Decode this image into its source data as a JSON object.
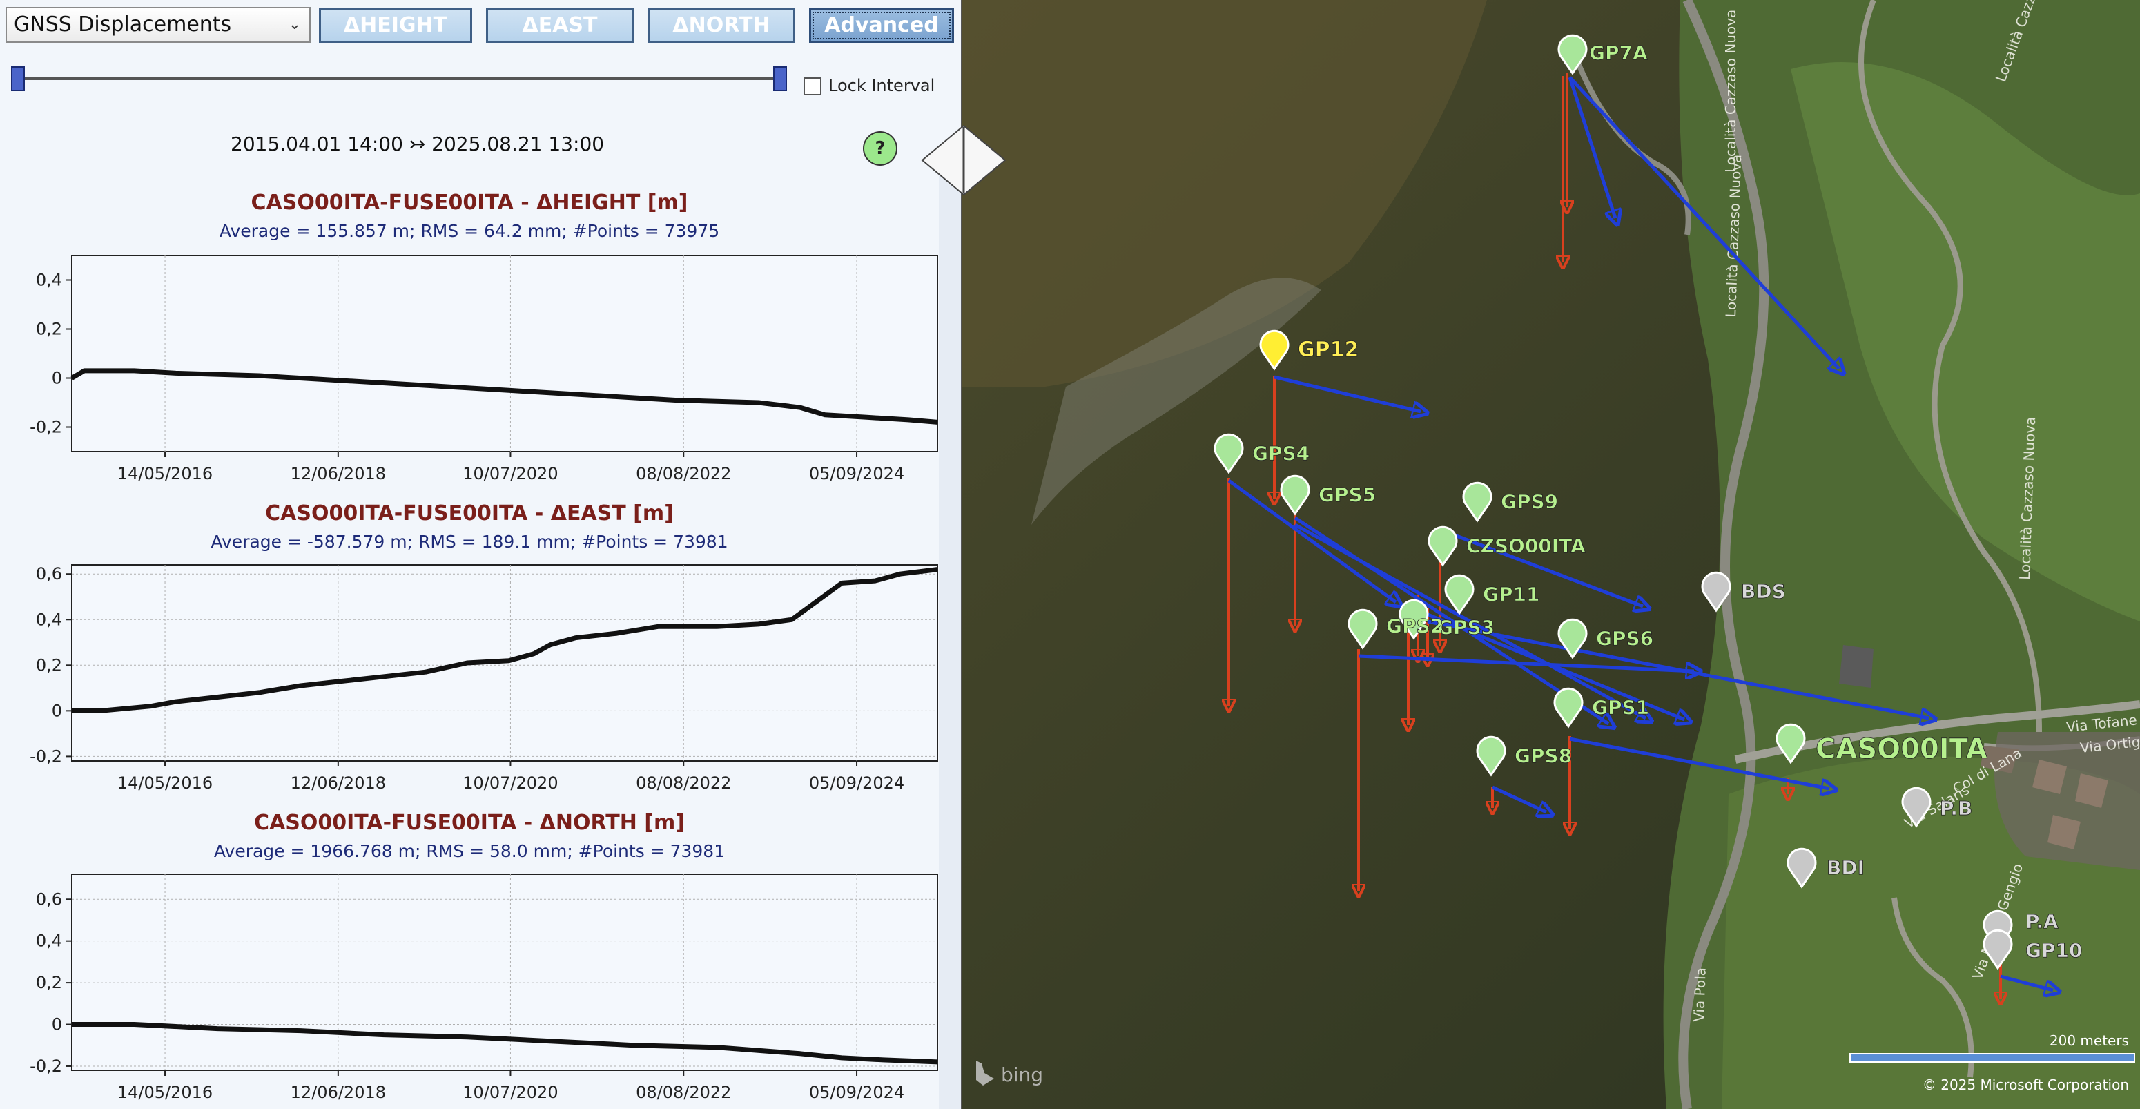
{
  "toolbar": {
    "dataset": "GNSS Displacements",
    "buttons": [
      "ΔHEIGHT",
      "ΔEAST",
      "ΔNORTH",
      "Advanced"
    ]
  },
  "interval": {
    "lock_label": "Lock Interval",
    "date_range": "2015.04.01 14:00 ↣ 2025.08.21 13:00"
  },
  "help": "?",
  "charts": [
    {
      "title": "CASO00ITA-FUSE00ITA - ΔHEIGHT [m]",
      "summary": "Average = 155.857 m; RMS = 64.2 mm; #Points = 73975",
      "ylim": [
        -0.3,
        0.5
      ],
      "yticks": [
        0.4,
        0.2,
        0,
        -0.2
      ],
      "ytick_labels": [
        "0,4",
        "0,2",
        "0",
        "-0,2"
      ],
      "xlim": [
        2015.25,
        2025.65
      ],
      "xticks": [
        2016.37,
        2018.45,
        2020.52,
        2022.6,
        2024.68
      ],
      "xtick_labels": [
        "14/05/2016",
        "12/06/2018",
        "10/07/2020",
        "08/08/2022",
        "05/09/2024"
      ],
      "series": [
        [
          2015.25,
          0.0
        ],
        [
          2015.4,
          0.03
        ],
        [
          2016.0,
          0.03
        ],
        [
          2016.5,
          0.02
        ],
        [
          2017.5,
          0.01
        ],
        [
          2018.5,
          -0.01
        ],
        [
          2019.5,
          -0.03
        ],
        [
          2020.5,
          -0.05
        ],
        [
          2021.5,
          -0.07
        ],
        [
          2022.5,
          -0.09
        ],
        [
          2023.5,
          -0.1
        ],
        [
          2024.0,
          -0.12
        ],
        [
          2024.3,
          -0.15
        ],
        [
          2024.8,
          -0.16
        ],
        [
          2025.3,
          -0.17
        ],
        [
          2025.65,
          -0.18
        ]
      ]
    },
    {
      "title": "CASO00ITA-FUSE00ITA - ΔEAST [m]",
      "summary": "Average = -587.579 m; RMS = 189.1 mm; #Points = 73981",
      "ylim": [
        -0.22,
        0.64
      ],
      "yticks": [
        0.6,
        0.4,
        0.2,
        0,
        -0.2
      ],
      "ytick_labels": [
        "0,6",
        "0,4",
        "0,2",
        "0",
        "-0,2"
      ],
      "xlim": [
        2015.25,
        2025.65
      ],
      "xticks": [
        2016.37,
        2018.45,
        2020.52,
        2022.6,
        2024.68
      ],
      "xtick_labels": [
        "14/05/2016",
        "12/06/2018",
        "10/07/2020",
        "08/08/2022",
        "05/09/2024"
      ],
      "series": [
        [
          2015.25,
          0.0
        ],
        [
          2015.6,
          0.0
        ],
        [
          2016.2,
          0.02
        ],
        [
          2016.5,
          0.04
        ],
        [
          2017.0,
          0.06
        ],
        [
          2017.5,
          0.08
        ],
        [
          2018.0,
          0.11
        ],
        [
          2018.5,
          0.13
        ],
        [
          2019.0,
          0.15
        ],
        [
          2019.5,
          0.17
        ],
        [
          2020.0,
          0.21
        ],
        [
          2020.5,
          0.22
        ],
        [
          2020.8,
          0.25
        ],
        [
          2021.0,
          0.29
        ],
        [
          2021.3,
          0.32
        ],
        [
          2021.8,
          0.34
        ],
        [
          2022.3,
          0.37
        ],
        [
          2023.0,
          0.37
        ],
        [
          2023.5,
          0.38
        ],
        [
          2023.9,
          0.4
        ],
        [
          2024.2,
          0.48
        ],
        [
          2024.5,
          0.56
        ],
        [
          2024.9,
          0.57
        ],
        [
          2025.2,
          0.6
        ],
        [
          2025.65,
          0.62
        ]
      ]
    },
    {
      "title": "CASO00ITA-FUSE00ITA - ΔNORTH [m]",
      "summary": "Average = 1966.768 m; RMS = 58.0 mm; #Points = 73981",
      "ylim": [
        -0.22,
        0.72
      ],
      "yticks": [
        0.6,
        0.4,
        0.2,
        0,
        -0.2
      ],
      "ytick_labels": [
        "0,6",
        "0,4",
        "0,2",
        "0",
        "-0,2"
      ],
      "xlim": [
        2015.25,
        2025.65
      ],
      "xticks": [
        2016.37,
        2018.45,
        2020.52,
        2022.6,
        2024.68
      ],
      "xtick_labels": [
        "14/05/2016",
        "12/06/2018",
        "10/07/2020",
        "08/08/2022",
        "05/09/2024"
      ],
      "series": [
        [
          2015.25,
          0.0
        ],
        [
          2016.0,
          0.0
        ],
        [
          2017.0,
          -0.02
        ],
        [
          2018.0,
          -0.03
        ],
        [
          2019.0,
          -0.05
        ],
        [
          2020.0,
          -0.06
        ],
        [
          2021.0,
          -0.08
        ],
        [
          2022.0,
          -0.1
        ],
        [
          2023.0,
          -0.11
        ],
        [
          2024.0,
          -0.14
        ],
        [
          2024.5,
          -0.16
        ],
        [
          2025.0,
          -0.17
        ],
        [
          2025.65,
          -0.18
        ]
      ]
    }
  ],
  "map": {
    "stations": [
      "GP7A",
      "GP12",
      "GPS4",
      "GPS5",
      "GPS9",
      "CZSO00ITA",
      "GP11",
      "GPS3",
      "GPS2",
      "GPS6",
      "GPS1",
      "GPS8",
      "CASO00ITA",
      "BDS",
      "BDI",
      "P.B",
      "P.A",
      "GP10"
    ],
    "roads": [
      "Località Cazzaso Nuova",
      "Località Cazzaso Nuova",
      "Località Cazzaso Nuova",
      "Località Cazzaso Nuova",
      "Via Tofane",
      "Via Ortigara",
      "Via Pola",
      "Via Salarìs",
      "Via Monte Gengio",
      "Col di Lana"
    ],
    "scale_label": "200 meters",
    "copyright": "© 2025 Microsoft Corporation",
    "brand": "bing"
  }
}
